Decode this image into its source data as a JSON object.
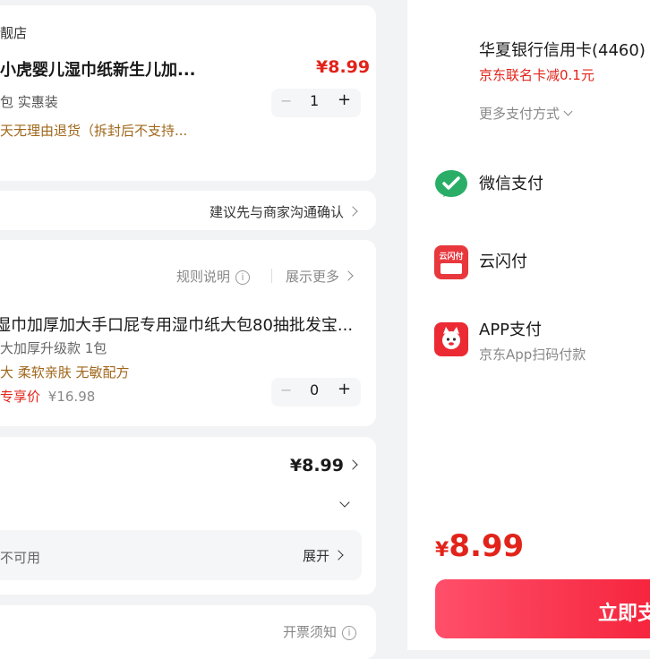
{
  "order": {
    "store_name": "靓店",
    "product1": {
      "title": "小虎婴儿湿巾纸新生儿加...",
      "price": "¥8.99",
      "spec": "包 实惠装",
      "return_policy": "天无理由退货（拆封后不支持...",
      "quantity": "1"
    },
    "contact_tip": "建议先与商家沟通确认",
    "addon": {
      "rules_label": "规则说明",
      "more_label": "展示更多",
      "title": "湿巾加厚加大手口屁专用湿巾纸大包80抽批发宝...",
      "spec": "大加厚升级款 1包",
      "tags": "大 柔软亲肤 无敏配方",
      "exclusive_label": "专享价",
      "exclusive_price": "¥16.98",
      "quantity": "0"
    },
    "summary": {
      "amount": "¥8.99",
      "unavailable_text": "不可用",
      "expand_label": "展开"
    },
    "invoice_notice": "开票须知"
  },
  "payment": {
    "card": {
      "name": "华夏银行信用卡(4460)",
      "promo": "京东联名卡减0.1元"
    },
    "more_methods": "更多支付方式",
    "methods": [
      {
        "icon": "wechat-pay-icon",
        "label": "微信支付",
        "sub": ""
      },
      {
        "icon": "unionpay-quickpass-icon",
        "label": "云闪付",
        "sub": ""
      },
      {
        "icon": "jd-app-icon",
        "label": "APP支付",
        "sub": "京东App扫码付款"
      }
    ],
    "total": "8.99",
    "currency_symbol": "¥",
    "pay_button": "立即支",
    "unionpay_icon_text": "云闪付"
  },
  "colors": {
    "price_red": "#e2231a",
    "promo_red": "#e2231a",
    "gold_text": "#a0671b",
    "wechat_green": "#2aae67",
    "pay_button_gradient_start": "#ff4f6a",
    "pay_button_gradient_end": "#f5223a"
  }
}
